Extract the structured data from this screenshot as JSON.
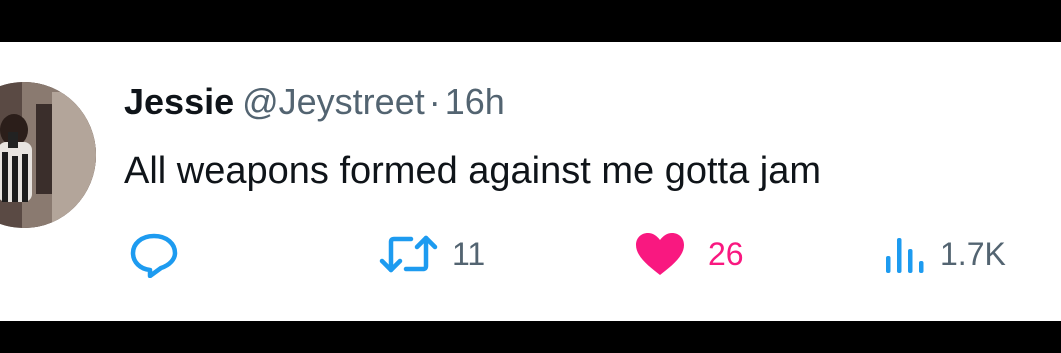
{
  "tweet": {
    "display_name": "Jessie",
    "handle": "@Jeystreet",
    "separator": "·",
    "time": "16h",
    "text": "All weapons formed against me gotta jam"
  },
  "actions": {
    "reply": {
      "icon": "reply-bubble-icon",
      "count": ""
    },
    "retweet": {
      "icon": "retweet-icon",
      "count": "11"
    },
    "like": {
      "icon": "heart-filled-icon",
      "count": "26",
      "liked": true
    },
    "views": {
      "icon": "bar-chart-icon",
      "count": "1.7K"
    }
  },
  "colors": {
    "text_primary": "#0f1419",
    "text_secondary": "#536471",
    "like_active": "#f91880",
    "background": "#ffffff",
    "frame": "#000000"
  }
}
